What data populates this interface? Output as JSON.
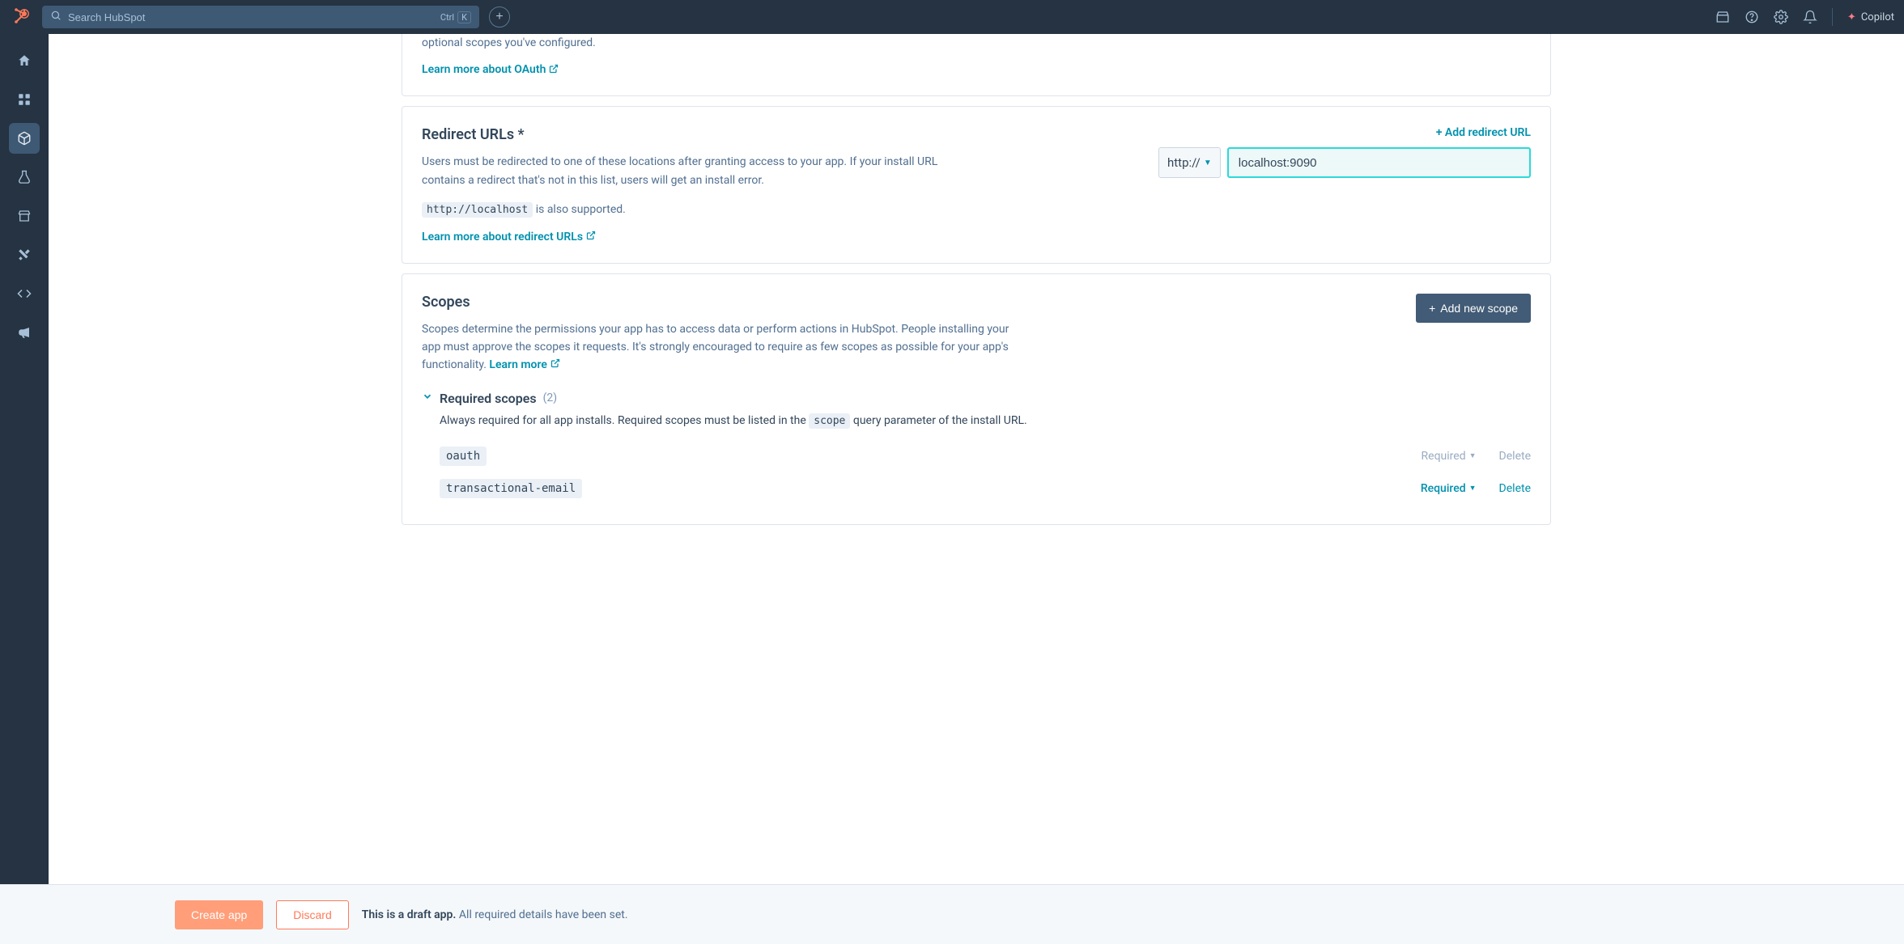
{
  "nav": {
    "search_placeholder": "Search HubSpot",
    "shortcut_ctrl": "Ctrl",
    "shortcut_key": "K",
    "copilot_label": "Copilot"
  },
  "oauth_card": {
    "partial_text": "optional scopes you've configured.",
    "learn_more": "Learn more about OAuth"
  },
  "redirect": {
    "title": "Redirect URLs *",
    "desc": "Users must be redirected to one of these locations after granting access to your app. If your install URL contains a redirect that's not in this list, users will get an install error.",
    "localhost_code": "http://localhost",
    "localhost_suffix": " is also supported.",
    "learn_more": "Learn more about redirect URLs",
    "add_label": "+ Add redirect URL",
    "protocol": "http://",
    "url_value": "localhost:9090"
  },
  "scopes": {
    "title": "Scopes",
    "desc": "Scopes determine the permissions your app has to access data or perform actions in HubSpot. People installing your app must approve the scopes it requests. It's strongly encouraged to require as few scopes as possible for your app's functionality. ",
    "learn_more_inline": "Learn more",
    "add_btn": "Add new scope",
    "required_title": "Required scopes",
    "required_count": "(2)",
    "required_desc_pre": "Always required for all app installs. Required scopes must be listed in the ",
    "required_desc_code": "scope",
    "required_desc_post": " query parameter of the install URL.",
    "items": [
      {
        "name": "oauth",
        "required_label": "Required",
        "delete_label": "Delete",
        "locked": true
      },
      {
        "name": "transactional-email",
        "required_label": "Required",
        "delete_label": "Delete",
        "locked": false
      }
    ]
  },
  "footer": {
    "create": "Create app",
    "discard": "Discard",
    "draft_bold": "This is a draft app.",
    "draft_rest": " All required details have been set."
  }
}
